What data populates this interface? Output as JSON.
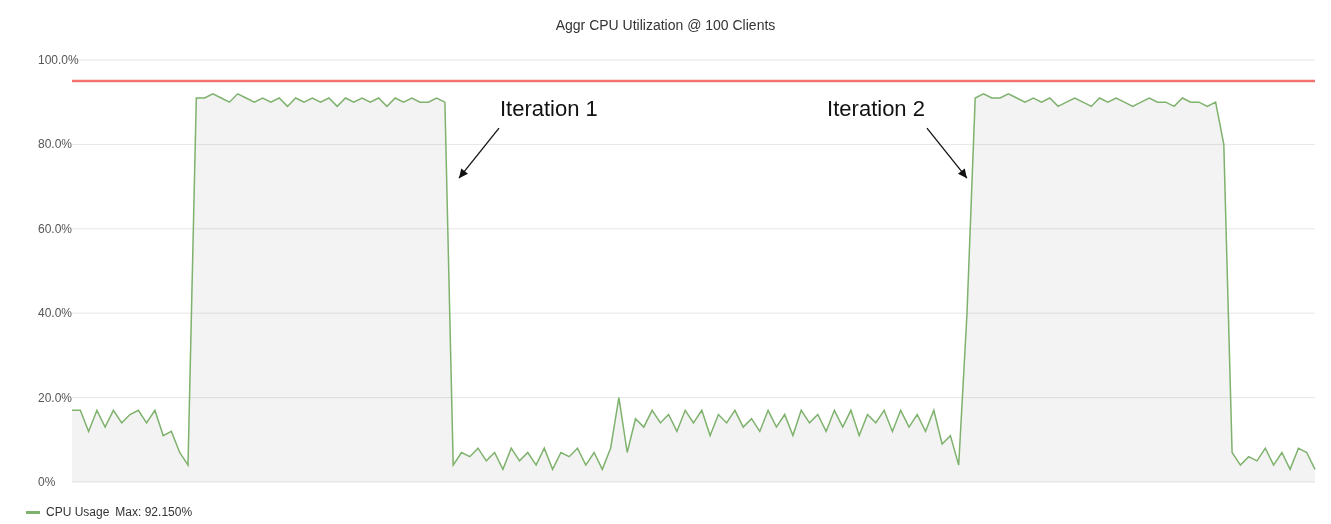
{
  "panel": {
    "title": "Aggr CPU Utilization @ 100 Clients",
    "chart_data": {
      "type": "area",
      "ylim": [
        0,
        100
      ],
      "yticks": [
        {
          "value": 0,
          "label": "0%"
        },
        {
          "value": 20,
          "label": "20.0%"
        },
        {
          "value": 40,
          "label": "40.0%"
        },
        {
          "value": 60,
          "label": "60.0%"
        },
        {
          "value": 80,
          "label": "80.0%"
        },
        {
          "value": 100,
          "label": "100.0%"
        }
      ],
      "series": [
        {
          "name": "CPU Usage",
          "color": "#7eb26d",
          "values": [
            17,
            17,
            12,
            17,
            13,
            17,
            14,
            16,
            17,
            14,
            17,
            11,
            12,
            7,
            4,
            91,
            91,
            92,
            91,
            90,
            92,
            91,
            90,
            91,
            90,
            91,
            89,
            91,
            90,
            91,
            90,
            91,
            89,
            91,
            90,
            91,
            90,
            91,
            89,
            91,
            90,
            91,
            90,
            90,
            91,
            90,
            4,
            7,
            6,
            8,
            5,
            7,
            3,
            8,
            5,
            7,
            4,
            8,
            3,
            7,
            6,
            8,
            4,
            7,
            3,
            8,
            20,
            7,
            15,
            13,
            17,
            14,
            16,
            12,
            17,
            14,
            17,
            11,
            16,
            14,
            17,
            13,
            15,
            12,
            17,
            13,
            16,
            11,
            17,
            14,
            16,
            12,
            17,
            13,
            17,
            11,
            16,
            14,
            17,
            12,
            17,
            13,
            16,
            12,
            17,
            9,
            11,
            4,
            40,
            91,
            92,
            91,
            91,
            92,
            91,
            90,
            91,
            90,
            91,
            89,
            90,
            91,
            90,
            89,
            91,
            90,
            91,
            90,
            89,
            90,
            91,
            90,
            90,
            89,
            91,
            90,
            90,
            89,
            90,
            80,
            7,
            4,
            6,
            5,
            8,
            4,
            7,
            3,
            8,
            7,
            3
          ]
        }
      ],
      "grid": true,
      "ref_lines": [
        {
          "axis": "y",
          "value": 95,
          "color": "#f2726f"
        }
      ],
      "annotations": [
        "Iteration 1",
        "Iteration 2"
      ]
    },
    "legend": [
      {
        "text": "Max: 92.150%"
      }
    ]
  }
}
